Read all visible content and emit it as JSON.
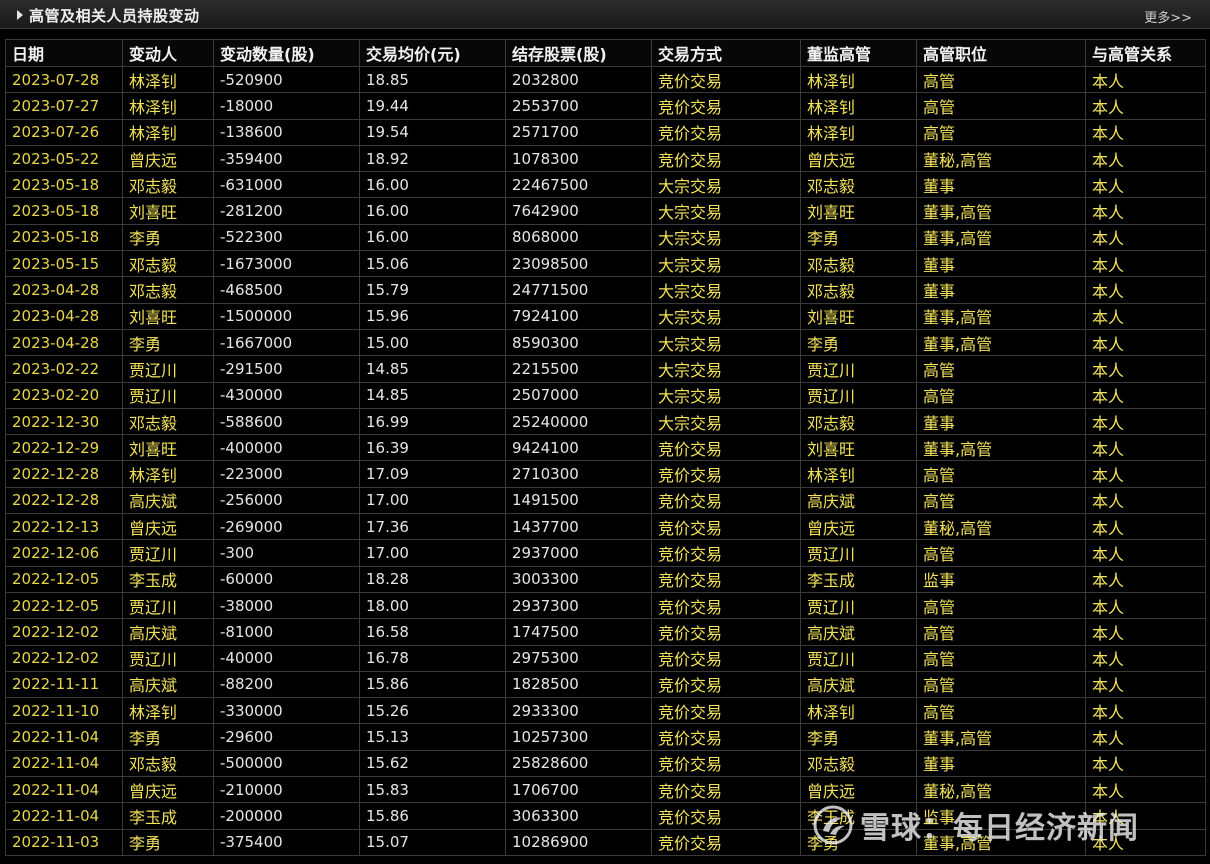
{
  "panel": {
    "title": "高管及相关人员持股变动",
    "more_label": "更多>>"
  },
  "table": {
    "headers": [
      "日期",
      "变动人",
      "变动数量(股)",
      "交易均价(元)",
      "结存股票(股)",
      "交易方式",
      "董监高管",
      "高管职位",
      "与高管关系"
    ],
    "rows": [
      [
        "2023-07-28",
        "林泽钊",
        "-520900",
        "18.85",
        "2032800",
        "竞价交易",
        "林泽钊",
        "高管",
        "本人"
      ],
      [
        "2023-07-27",
        "林泽钊",
        "-18000",
        "19.44",
        "2553700",
        "竞价交易",
        "林泽钊",
        "高管",
        "本人"
      ],
      [
        "2023-07-26",
        "林泽钊",
        "-138600",
        "19.54",
        "2571700",
        "竞价交易",
        "林泽钊",
        "高管",
        "本人"
      ],
      [
        "2023-05-22",
        "曾庆远",
        "-359400",
        "18.92",
        "1078300",
        "竞价交易",
        "曾庆远",
        "董秘,高管",
        "本人"
      ],
      [
        "2023-05-18",
        "邓志毅",
        "-631000",
        "16.00",
        "22467500",
        "大宗交易",
        "邓志毅",
        "董事",
        "本人"
      ],
      [
        "2023-05-18",
        "刘喜旺",
        "-281200",
        "16.00",
        "7642900",
        "大宗交易",
        "刘喜旺",
        "董事,高管",
        "本人"
      ],
      [
        "2023-05-18",
        "李勇",
        "-522300",
        "16.00",
        "8068000",
        "大宗交易",
        "李勇",
        "董事,高管",
        "本人"
      ],
      [
        "2023-05-15",
        "邓志毅",
        "-1673000",
        "15.06",
        "23098500",
        "大宗交易",
        "邓志毅",
        "董事",
        "本人"
      ],
      [
        "2023-04-28",
        "邓志毅",
        "-468500",
        "15.79",
        "24771500",
        "大宗交易",
        "邓志毅",
        "董事",
        "本人"
      ],
      [
        "2023-04-28",
        "刘喜旺",
        "-1500000",
        "15.96",
        "7924100",
        "大宗交易",
        "刘喜旺",
        "董事,高管",
        "本人"
      ],
      [
        "2023-04-28",
        "李勇",
        "-1667000",
        "15.00",
        "8590300",
        "大宗交易",
        "李勇",
        "董事,高管",
        "本人"
      ],
      [
        "2023-02-22",
        "贾辽川",
        "-291500",
        "14.85",
        "2215500",
        "大宗交易",
        "贾辽川",
        "高管",
        "本人"
      ],
      [
        "2023-02-20",
        "贾辽川",
        "-430000",
        "14.85",
        "2507000",
        "大宗交易",
        "贾辽川",
        "高管",
        "本人"
      ],
      [
        "2022-12-30",
        "邓志毅",
        "-588600",
        "16.99",
        "25240000",
        "大宗交易",
        "邓志毅",
        "董事",
        "本人"
      ],
      [
        "2022-12-29",
        "刘喜旺",
        "-400000",
        "16.39",
        "9424100",
        "竞价交易",
        "刘喜旺",
        "董事,高管",
        "本人"
      ],
      [
        "2022-12-28",
        "林泽钊",
        "-223000",
        "17.09",
        "2710300",
        "竞价交易",
        "林泽钊",
        "高管",
        "本人"
      ],
      [
        "2022-12-28",
        "高庆斌",
        "-256000",
        "17.00",
        "1491500",
        "竞价交易",
        "高庆斌",
        "高管",
        "本人"
      ],
      [
        "2022-12-13",
        "曾庆远",
        "-269000",
        "17.36",
        "1437700",
        "竞价交易",
        "曾庆远",
        "董秘,高管",
        "本人"
      ],
      [
        "2022-12-06",
        "贾辽川",
        "-300",
        "17.00",
        "2937000",
        "竞价交易",
        "贾辽川",
        "高管",
        "本人"
      ],
      [
        "2022-12-05",
        "李玉成",
        "-60000",
        "18.28",
        "3003300",
        "竞价交易",
        "李玉成",
        "监事",
        "本人"
      ],
      [
        "2022-12-05",
        "贾辽川",
        "-38000",
        "18.00",
        "2937300",
        "竞价交易",
        "贾辽川",
        "高管",
        "本人"
      ],
      [
        "2022-12-02",
        "高庆斌",
        "-81000",
        "16.58",
        "1747500",
        "竞价交易",
        "高庆斌",
        "高管",
        "本人"
      ],
      [
        "2022-12-02",
        "贾辽川",
        "-40000",
        "16.78",
        "2975300",
        "竞价交易",
        "贾辽川",
        "高管",
        "本人"
      ],
      [
        "2022-11-11",
        "高庆斌",
        "-88200",
        "15.86",
        "1828500",
        "竞价交易",
        "高庆斌",
        "高管",
        "本人"
      ],
      [
        "2022-11-10",
        "林泽钊",
        "-330000",
        "15.26",
        "2933300",
        "竞价交易",
        "林泽钊",
        "高管",
        "本人"
      ],
      [
        "2022-11-04",
        "李勇",
        "-29600",
        "15.13",
        "10257300",
        "竞价交易",
        "李勇",
        "董事,高管",
        "本人"
      ],
      [
        "2022-11-04",
        "邓志毅",
        "-500000",
        "15.62",
        "25828600",
        "竞价交易",
        "邓志毅",
        "董事",
        "本人"
      ],
      [
        "2022-11-04",
        "曾庆远",
        "-210000",
        "15.83",
        "1706700",
        "竞价交易",
        "曾庆远",
        "董秘,高管",
        "本人"
      ],
      [
        "2022-11-04",
        "李玉成",
        "-200000",
        "15.86",
        "3063300",
        "竞价交易",
        "李玉成",
        "监事",
        "本人"
      ],
      [
        "2022-11-03",
        "李勇",
        "-375400",
        "15.07",
        "10286900",
        "竞价交易",
        "李勇",
        "董事,高管",
        "本人"
      ]
    ]
  },
  "watermark": {
    "text": "雪球：每日经济新闻"
  }
}
